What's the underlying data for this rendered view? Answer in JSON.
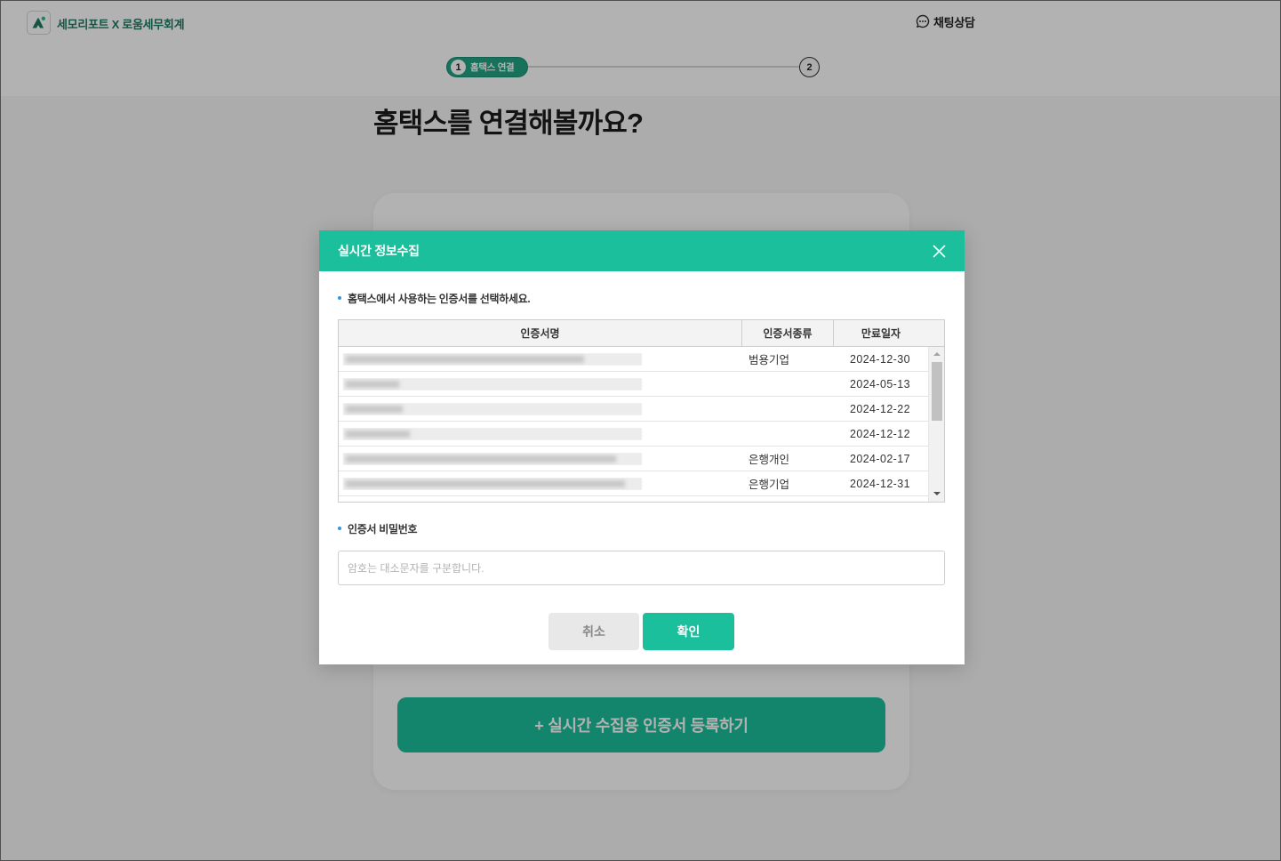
{
  "header": {
    "logo_icon": "mountain-logo-icon",
    "brand": "세모리포트 X 로움세무회계",
    "chat_icon": "chat-bubble-icon",
    "chat_label": "채팅상담"
  },
  "stepper": {
    "current_step": 1,
    "steps": [
      {
        "number": "1",
        "label": "홈택스 연결"
      },
      {
        "number": "2"
      }
    ]
  },
  "page": {
    "title": "홈택스를 연결해볼까요?",
    "register_button": "+ 실시간 수집용 인증서 등록하기"
  },
  "modal": {
    "title": "실시간 정보수집",
    "close_icon": "close-icon",
    "cert_instruction": "홈택스에서 사용하는 인증서를 선택하세요.",
    "table": {
      "columns": [
        "인증서명",
        "인증서종류",
        "만료일자"
      ],
      "rows": [
        {
          "name_redacted": true,
          "type": "범용기업",
          "expiry": "2024-12-30"
        },
        {
          "name_redacted": true,
          "type": "",
          "expiry": "2024-05-13"
        },
        {
          "name_redacted": true,
          "type": "",
          "expiry": "2024-12-22"
        },
        {
          "name_redacted": true,
          "type": "",
          "expiry": "2024-12-12"
        },
        {
          "name_redacted": true,
          "type": "은행개인",
          "expiry": "2024-02-17"
        },
        {
          "name_redacted": true,
          "type": "은행기업",
          "expiry": "2024-12-31"
        }
      ]
    },
    "password_label": "인증서 비밀번호",
    "password_placeholder": "암호는 대소문자를 구분합니다.",
    "password_value": "",
    "cancel_label": "취소",
    "confirm_label": "확인"
  },
  "colors": {
    "accent": "#1bbf9b",
    "bullet": "#2f97e0"
  }
}
